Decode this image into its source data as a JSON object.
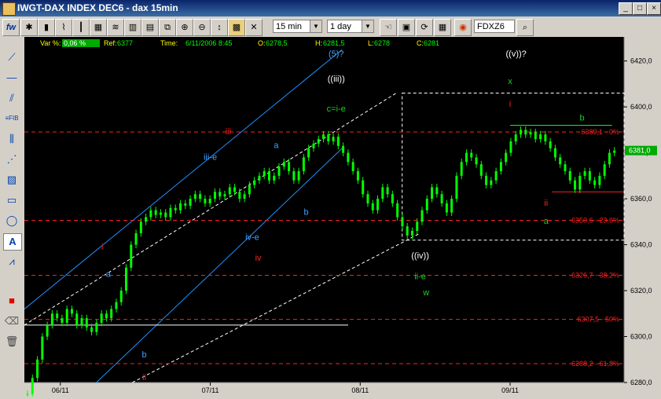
{
  "window": {
    "title": "IWGT-DAX INDEX DEC6 - dax 15min",
    "controls": [
      "_",
      "□",
      "×"
    ]
  },
  "toolbar": {
    "logo": "fw",
    "interval": "15 min",
    "period": "1 day",
    "symbol": "FDXZ6",
    "icons": [
      "pointer-icon",
      "open-icon",
      "save-icon",
      "refresh-icon",
      "grid-icon",
      "zoom-icon"
    ]
  },
  "info": {
    "var_label": "Var %:",
    "var_value": "0,06 %",
    "ref_label": "Ref:",
    "ref_value": "6377",
    "time_label": "Time:",
    "time_value": "6/11/2006 8:45",
    "open_label": "O:",
    "open_value": "6278,5",
    "high_label": "H:",
    "high_value": "6281,5",
    "low_label": "L:",
    "low_value": "6278",
    "close_label": "C:",
    "close_value": "6281"
  },
  "colors": {
    "background": "#000000",
    "candles": "#00ff00",
    "fib": "#ff2020",
    "channel": "#1e90ff",
    "white": "#ffffff",
    "green_label": "#22cc22",
    "cyan_label": "#40a0ff"
  },
  "chart_data": {
    "type": "line",
    "title": "",
    "ylim": [
      6280,
      6425
    ],
    "y_ticks": [
      "6420,0",
      "6400,0",
      "6380,0",
      "6360,0",
      "6340,0",
      "6320,0",
      "6300,0",
      "6280,0"
    ],
    "y_tick_values": [
      6420,
      6400,
      6380,
      6360,
      6340,
      6320,
      6300,
      6280
    ],
    "x_ticks": [
      "06/11",
      "07/11",
      "08/11",
      "09/11"
    ],
    "last_price_label": "6381,0",
    "last_price": 6381,
    "fib_levels": [
      {
        "label": "6389,1 - 0%",
        "value": 6389.1
      },
      {
        "label": "6350,6 - 23,6%",
        "value": 6350.6
      },
      {
        "label": "6326,7 - 38,2%",
        "value": 6326.7
      },
      {
        "label": "6307,5 - 50%",
        "value": 6307.5
      },
      {
        "label": "6288,2 - 61,8%",
        "value": 6288.2
      }
    ],
    "series": [
      {
        "values": [
          6275,
          6282,
          6290,
          6300,
          6305,
          6310,
          6308,
          6306,
          6312,
          6310,
          6305,
          6308,
          6304,
          6302,
          6306,
          6310,
          6308,
          6312,
          6315,
          6320,
          6330,
          6340,
          6345,
          6350,
          6352,
          6355,
          6353,
          6354,
          6352,
          6356,
          6355,
          6358,
          6357,
          6360,
          6362,
          6360,
          6358,
          6360,
          6363,
          6361,
          6362,
          6365,
          6363,
          6360,
          6362,
          6366,
          6368,
          6370,
          6372,
          6368,
          6370,
          6374,
          6376,
          6372,
          6368,
          6372,
          6378,
          6382,
          6384,
          6386,
          6388,
          6385,
          6387,
          6383,
          6380,
          6376,
          6372,
          6368,
          6362,
          6358,
          6355,
          6360,
          6365,
          6362,
          6358,
          6352,
          6348,
          6344,
          6346,
          6350,
          6355,
          6360,
          6365,
          6362,
          6358,
          6354,
          6360,
          6370,
          6376,
          6380,
          6378,
          6375,
          6370,
          6366,
          6368,
          6372,
          6376,
          6380,
          6385,
          6388,
          6390,
          6388,
          6389,
          6386,
          6388,
          6385,
          6382,
          6378,
          6375,
          6372,
          6368,
          6364,
          6370,
          6372,
          6368,
          6366,
          6370,
          6375,
          6380,
          6381
        ]
      }
    ],
    "wave_labels": [
      {
        "text": "(5)?",
        "color": "cyan",
        "x": 0.52,
        "y": 6422
      },
      {
        "text": "((iii))",
        "color": "white",
        "x": 0.52,
        "y": 6411
      },
      {
        "text": "c=i-e",
        "color": "green",
        "x": 0.52,
        "y": 6398
      },
      {
        "text": "iii",
        "color": "red",
        "x": 0.34,
        "y": 6388
      },
      {
        "text": "iii-e",
        "color": "cyan",
        "x": 0.31,
        "y": 6377
      },
      {
        "text": "a",
        "color": "cyan",
        "x": 0.42,
        "y": 6382
      },
      {
        "text": "b",
        "color": "cyan",
        "x": 0.47,
        "y": 6353
      },
      {
        "text": "iv-e",
        "color": "cyan",
        "x": 0.38,
        "y": 6342
      },
      {
        "text": "iv",
        "color": "red",
        "x": 0.39,
        "y": 6333
      },
      {
        "text": "i",
        "color": "red",
        "x": 0.13,
        "y": 6338
      },
      {
        "text": "a",
        "color": "cyan",
        "x": 0.14,
        "y": 6326
      },
      {
        "text": "b",
        "color": "cyan",
        "x": 0.2,
        "y": 6291
      },
      {
        "text": "ii",
        "color": "red",
        "x": 0.2,
        "y": 6281
      },
      {
        "text": "((iv))",
        "color": "white",
        "x": 0.66,
        "y": 6334
      },
      {
        "text": "ii-e",
        "color": "green",
        "x": 0.66,
        "y": 6325
      },
      {
        "text": "w",
        "color": "green",
        "x": 0.67,
        "y": 6318
      },
      {
        "text": "((v))?",
        "color": "white",
        "x": 0.82,
        "y": 6422
      },
      {
        "text": "x",
        "color": "green",
        "x": 0.81,
        "y": 6410
      },
      {
        "text": "i",
        "color": "red",
        "x": 0.81,
        "y": 6400
      },
      {
        "text": "b",
        "color": "green",
        "x": 0.93,
        "y": 6394
      },
      {
        "text": "ii",
        "color": "red",
        "x": 0.87,
        "y": 6357
      },
      {
        "text": "a",
        "color": "green",
        "x": 0.87,
        "y": 6349
      }
    ]
  }
}
